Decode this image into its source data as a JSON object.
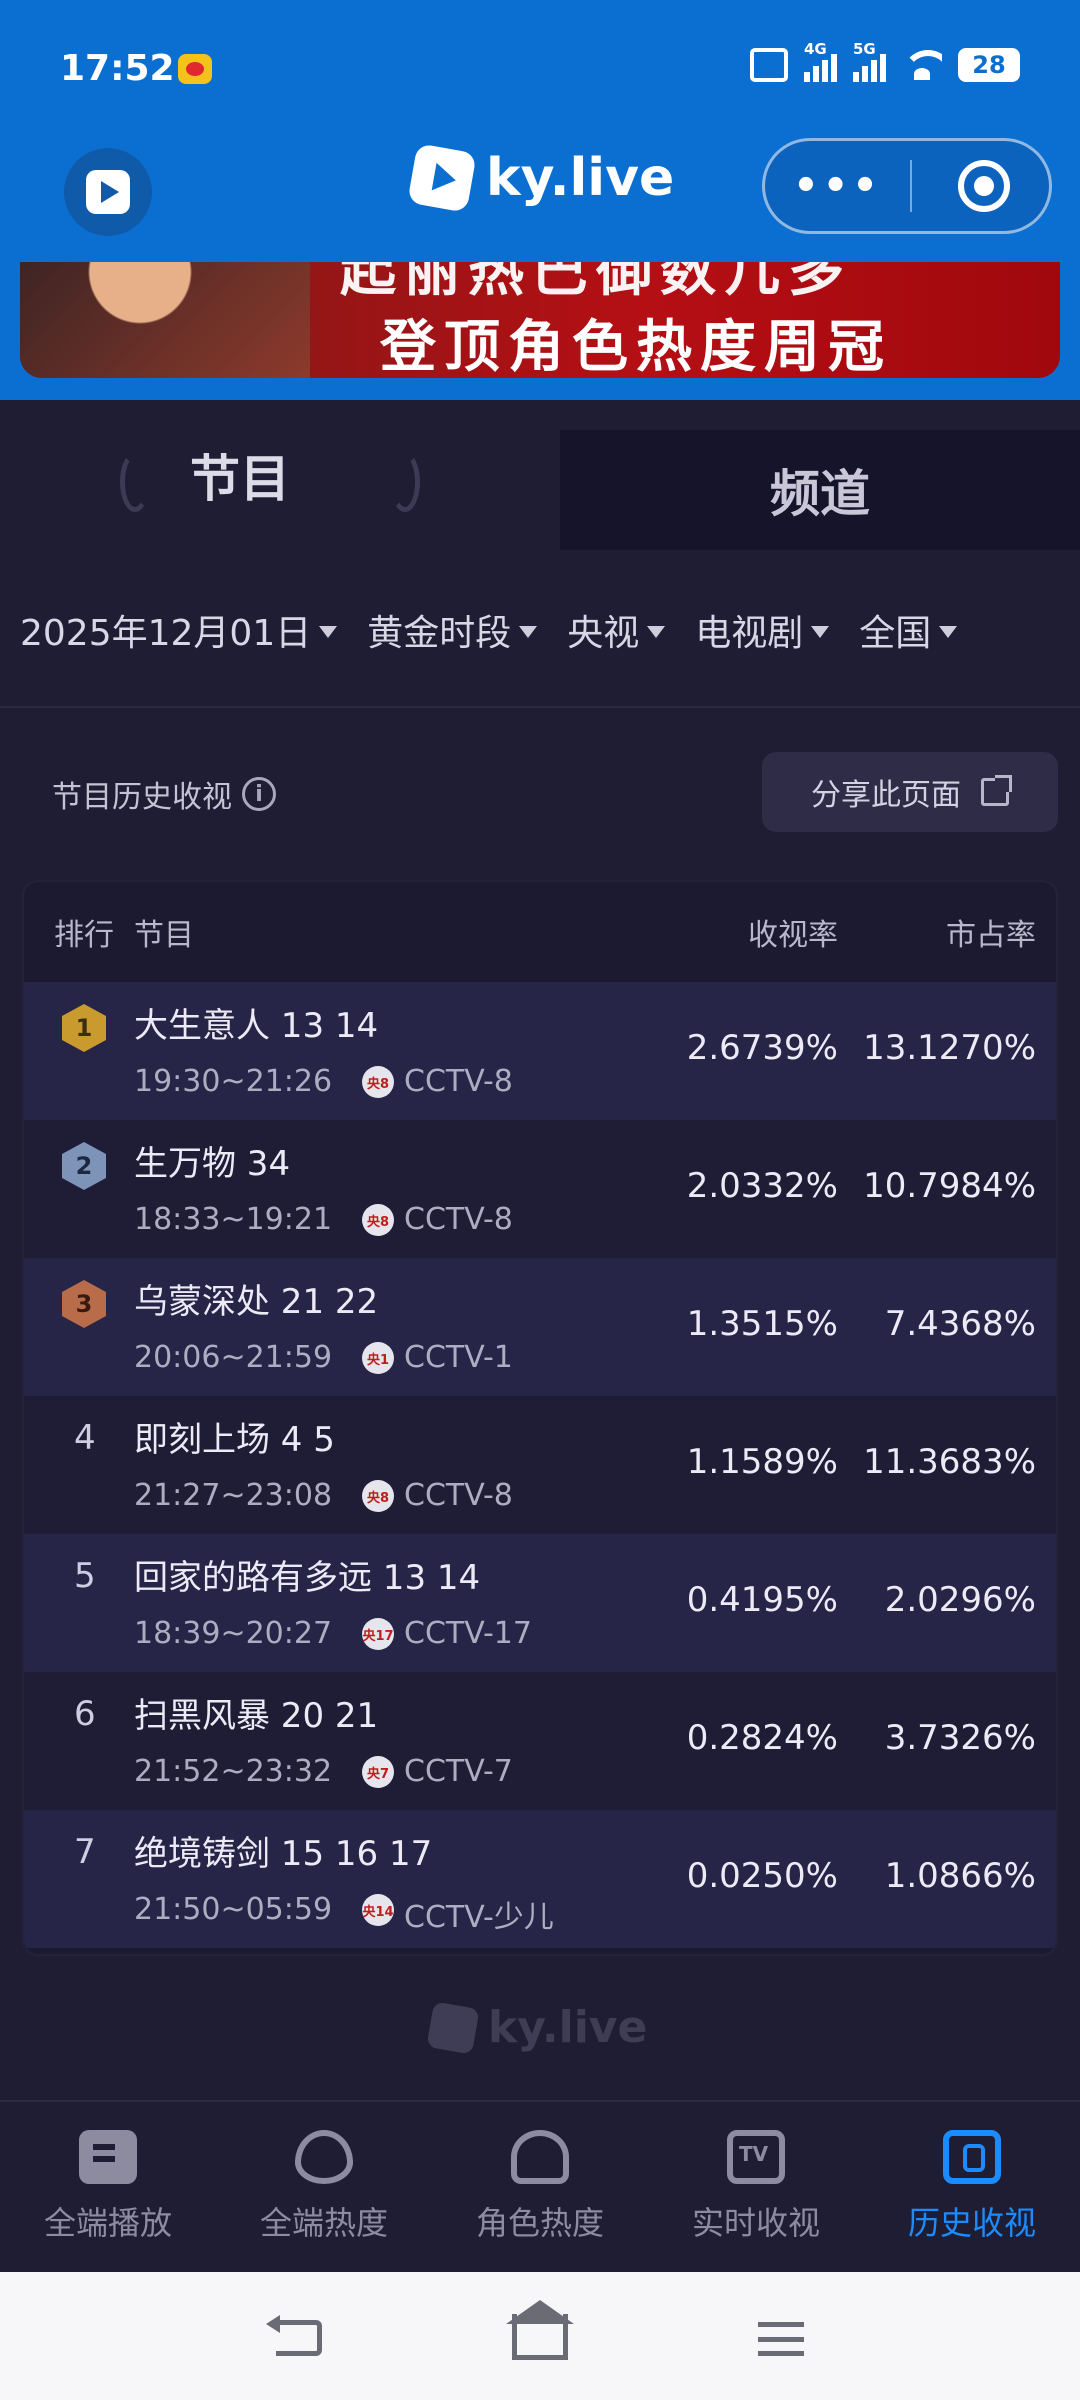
{
  "status_bar": {
    "time": "17:52",
    "net1": "4G",
    "net2": "5G",
    "battery": "28"
  },
  "header": {
    "brand": "ky.live",
    "menu_dots": "•••"
  },
  "banner": {
    "line1": "起丽热巴御数几多",
    "line2": "登顶角色热度周冠"
  },
  "tabs": {
    "program": "节目",
    "channel": "频道"
  },
  "filters": [
    {
      "label": "2025年12月01日"
    },
    {
      "label": "黄金时段"
    },
    {
      "label": "央视"
    },
    {
      "label": "电视剧"
    },
    {
      "label": "全国"
    }
  ],
  "section": {
    "title": "节目历史收视",
    "info": "i",
    "share_button": "分享此页面"
  },
  "table": {
    "headers": {
      "rank": "排行",
      "program": "节目",
      "rating": "收视率",
      "share": "市占率"
    },
    "rows": [
      {
        "rank": "1",
        "name": "大生意人 13 14",
        "time": "19:30~21:26",
        "ch_logo": "央8",
        "channel": "CCTV-8",
        "rating": "2.6739%",
        "share": "13.1270%"
      },
      {
        "rank": "2",
        "name": "生万物 34",
        "time": "18:33~19:21",
        "ch_logo": "央8",
        "channel": "CCTV-8",
        "rating": "2.0332%",
        "share": "10.7984%"
      },
      {
        "rank": "3",
        "name": "乌蒙深处 21 22",
        "time": "20:06~21:59",
        "ch_logo": "央1",
        "channel": "CCTV-1",
        "rating": "1.3515%",
        "share": "7.4368%"
      },
      {
        "rank": "4",
        "name": "即刻上场 4 5",
        "time": "21:27~23:08",
        "ch_logo": "央8",
        "channel": "CCTV-8",
        "rating": "1.1589%",
        "share": "11.3683%"
      },
      {
        "rank": "5",
        "name": "回家的路有多远 13 14",
        "time": "18:39~20:27",
        "ch_logo": "央17",
        "channel": "CCTV-17",
        "rating": "0.4195%",
        "share": "2.0296%"
      },
      {
        "rank": "6",
        "name": "扫黑风暴 20 21",
        "time": "21:52~23:32",
        "ch_logo": "央7",
        "channel": "CCTV-7",
        "rating": "0.2824%",
        "share": "3.7326%"
      },
      {
        "rank": "7",
        "name": "绝境铸剑 15 16 17",
        "time": "21:50~05:59",
        "ch_logo": "央14",
        "channel": "CCTV-少儿",
        "rating": "0.0250%",
        "share": "1.0866%"
      }
    ]
  },
  "footer": {
    "brand": "ky.live"
  },
  "bottom_tabs": [
    {
      "label": "全端播放"
    },
    {
      "label": "全端热度"
    },
    {
      "label": "角色热度"
    },
    {
      "label": "实时收视"
    },
    {
      "label": "历史收视"
    }
  ],
  "colors": {
    "header_blue": "#0a6fd1",
    "accent": "#1b8cff",
    "gold": "#c99a2e",
    "silver": "#7d93b8",
    "bronze": "#b86c4a"
  }
}
